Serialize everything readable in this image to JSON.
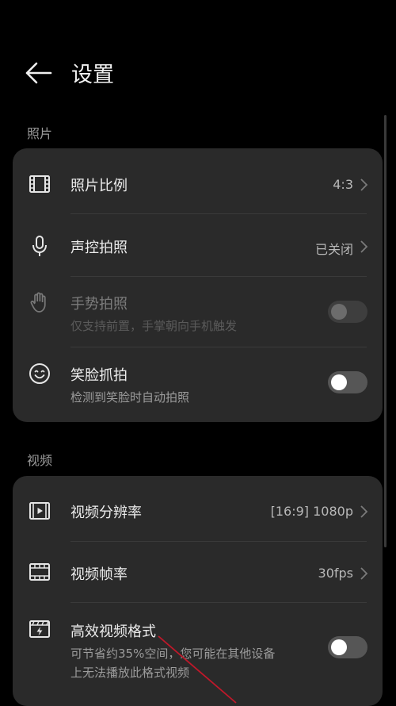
{
  "header": {
    "title": "设置",
    "back_icon": "arrow-left-icon"
  },
  "sections": [
    {
      "label": "照片",
      "items": [
        {
          "label": "照片比例",
          "value": "4:3",
          "icon": "film-frame-icon",
          "control": "chevron"
        },
        {
          "label": "声控拍照",
          "value": "已关闭",
          "icon": "microphone-icon",
          "control": "chevron"
        },
        {
          "label": "手势拍照",
          "sub": "仅支持前置，手掌朝向手机触发",
          "icon": "hand-palm-icon",
          "control": "toggle",
          "on": false,
          "disabled": true
        },
        {
          "label": "笑脸抓拍",
          "sub": "检测到笑脸时自动拍照",
          "icon": "smile-face-icon",
          "control": "toggle",
          "on": false
        }
      ]
    },
    {
      "label": "视频",
      "items": [
        {
          "label": "视频分辨率",
          "value": "[16:9] 1080p",
          "icon": "video-frame-icon",
          "control": "chevron"
        },
        {
          "label": "视频帧率",
          "value": "30fps",
          "icon": "film-strip-icon",
          "control": "chevron"
        },
        {
          "label": "高效视频格式",
          "sub": "可节省约35%空间，您可能在其他设备\n上无法播放此格式视频",
          "icon": "clapper-flash-icon",
          "control": "toggle",
          "on": false
        }
      ]
    }
  ],
  "colors": {
    "background": "#000000",
    "card": "#2a2a2a",
    "annotation_arrow": "#c0182a"
  }
}
